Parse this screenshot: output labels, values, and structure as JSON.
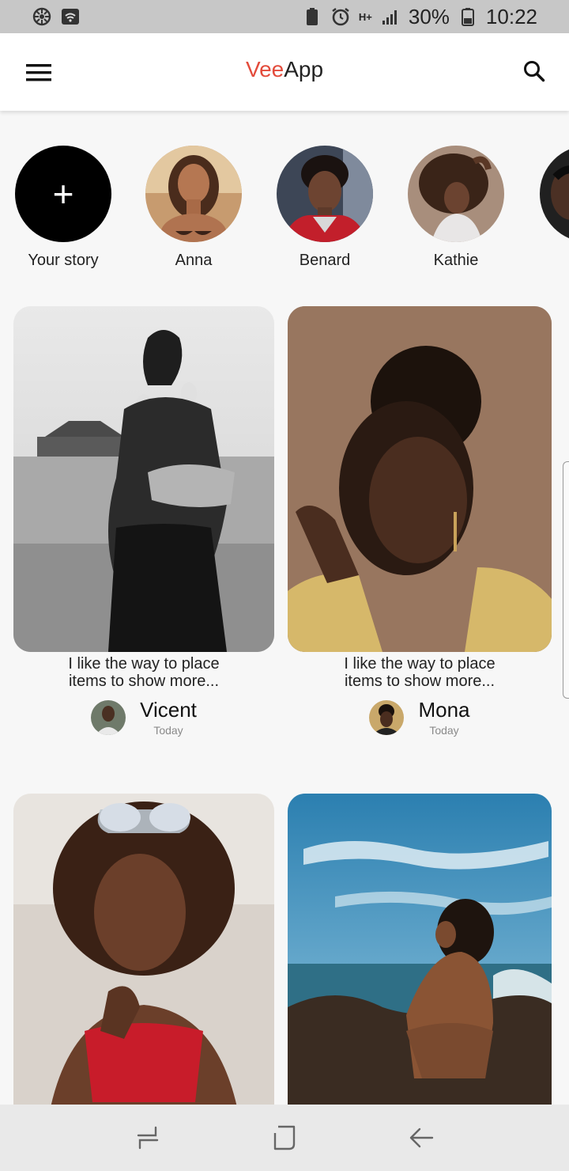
{
  "status_bar": {
    "battery": "30%",
    "time": "10:22",
    "network": "H+"
  },
  "app_bar": {
    "title_part1": "Vee",
    "title_part2": "App",
    "colors": {
      "accent": "#e34b3b"
    }
  },
  "stories": [
    {
      "name": "Your story",
      "type": "add"
    },
    {
      "name": "Anna"
    },
    {
      "name": "Benard"
    },
    {
      "name": "Kathie"
    },
    {
      "name": ""
    }
  ],
  "feed": [
    {
      "caption": "I like the way to place items to show more...",
      "author": "Vicent",
      "when": "Today"
    },
    {
      "caption": "I like the way to place items to show more...",
      "author": "Mona",
      "when": "Today"
    },
    {
      "caption": "",
      "author": "",
      "when": ""
    },
    {
      "caption": "",
      "author": "",
      "when": ""
    }
  ],
  "icons": {
    "menu": "menu-icon",
    "search": "search-icon",
    "add": "plus-icon",
    "nav_recent": "recent-apps-icon",
    "nav_home": "home-icon",
    "nav_back": "back-icon"
  }
}
